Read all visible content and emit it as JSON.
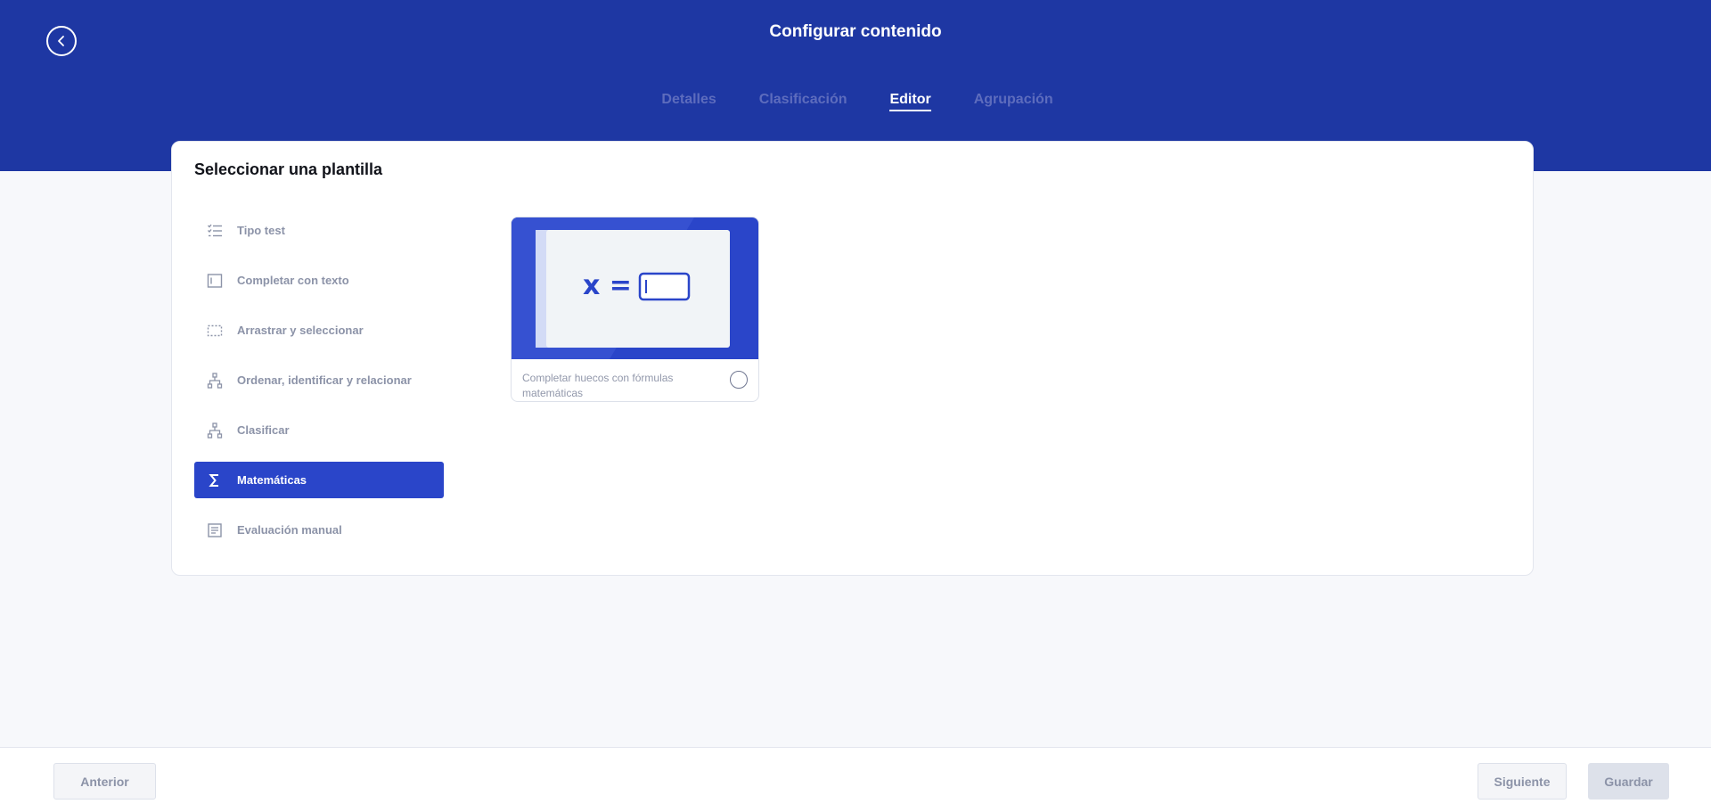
{
  "header": {
    "title": "Configurar contenido",
    "back_icon": "chevron-left-icon",
    "tabs": [
      {
        "label": "Detalles",
        "active": false
      },
      {
        "label": "Clasificación",
        "active": false
      },
      {
        "label": "Editor",
        "active": true
      },
      {
        "label": "Agrupación",
        "active": false
      }
    ]
  },
  "panel": {
    "title": "Seleccionar una plantilla",
    "templates": [
      {
        "label": "Tipo test",
        "icon": "checklist-icon",
        "active": false
      },
      {
        "label": "Completar con texto",
        "icon": "text-field-icon",
        "active": false
      },
      {
        "label": "Arrastrar y seleccionar",
        "icon": "dashed-box-icon",
        "active": false
      },
      {
        "label": "Ordenar, identificar y relacionar",
        "icon": "hierarchy-icon",
        "active": false
      },
      {
        "label": "Clasificar",
        "icon": "hierarchy-icon",
        "active": false
      },
      {
        "label": "Matemáticas",
        "icon": "sigma-icon",
        "active": true
      },
      {
        "label": "Evaluación manual",
        "icon": "document-lines-icon",
        "active": false
      }
    ],
    "option": {
      "caption": "Completar huecos con fórmulas matemáticas",
      "preview_formula": "x =",
      "selected": false
    }
  },
  "footer": {
    "prev_label": "Anterior",
    "next_label": "Siguiente",
    "save_label": "Guardar"
  },
  "colors": {
    "primary": "#1e37a3",
    "accent": "#2a45c9",
    "muted_text": "#8c93a8"
  }
}
